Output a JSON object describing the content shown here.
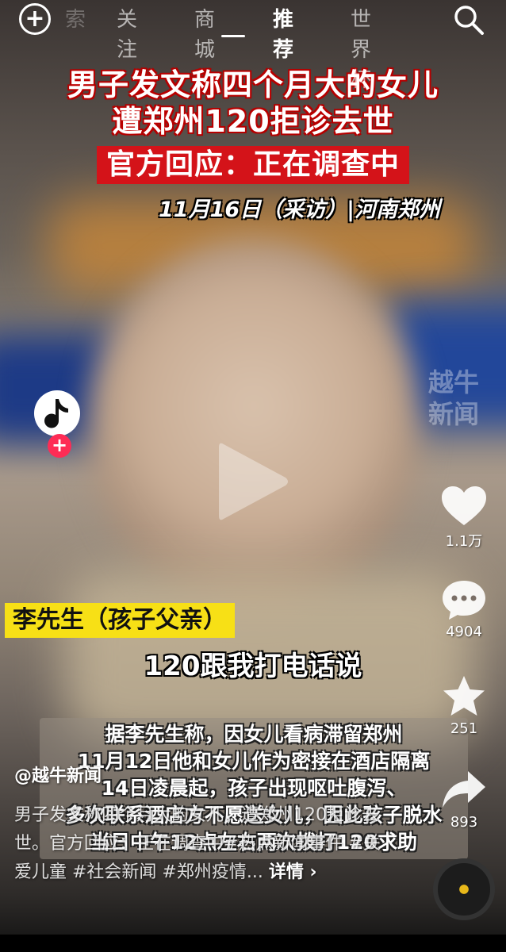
{
  "top_nav": {
    "tabs": [
      "索",
      "关注",
      "商城",
      "推荐",
      "世界杯"
    ],
    "active_tab": "推荐"
  },
  "video": {
    "headline_line1": "男子发文称四个月大的女儿",
    "headline_line2": "遭郑州120拒诊去世",
    "headline_box": "官方回应：正在调查中",
    "dateline": "11月16日（采访）|河南郑州",
    "watermark": "越牛新闻",
    "speaker_tag": "李先生（孩子父亲）",
    "subtitle": "120跟我打电话说",
    "quote_lines": [
      "据李先生称，因女儿看病滞留郑州",
      "11月12日他和女儿作为密接在酒店隔离",
      "14日凌晨起，孩子出现呕吐腹泻、",
      "多次联系酒店方不愿送女儿，因此孩子脱水",
      "当日中午12点左右两次拨打120求助"
    ]
  },
  "actions": {
    "like_count": "1.1万",
    "comment_count": "4904",
    "favorite_count": "251",
    "share_count": "893",
    "follow_symbol": "+"
  },
  "post": {
    "author": "@越牛新闻",
    "description": "男子发文称四个月大的女儿，遭郑州120拒诊去世。官方回应：正在调查中#热点新闻事件 #关爱儿童 #社会新闻 #郑州疫情...",
    "more_label": "详情"
  },
  "colors": {
    "accent_red": "#d41319",
    "follow_pink": "#fe2c55",
    "caption_yellow": "#f7e016"
  },
  "icons": [
    "plus-circle-icon",
    "search-icon",
    "play-icon",
    "music-note-icon",
    "heart-icon",
    "comment-icon",
    "star-icon",
    "share-icon",
    "music-disc-icon"
  ]
}
